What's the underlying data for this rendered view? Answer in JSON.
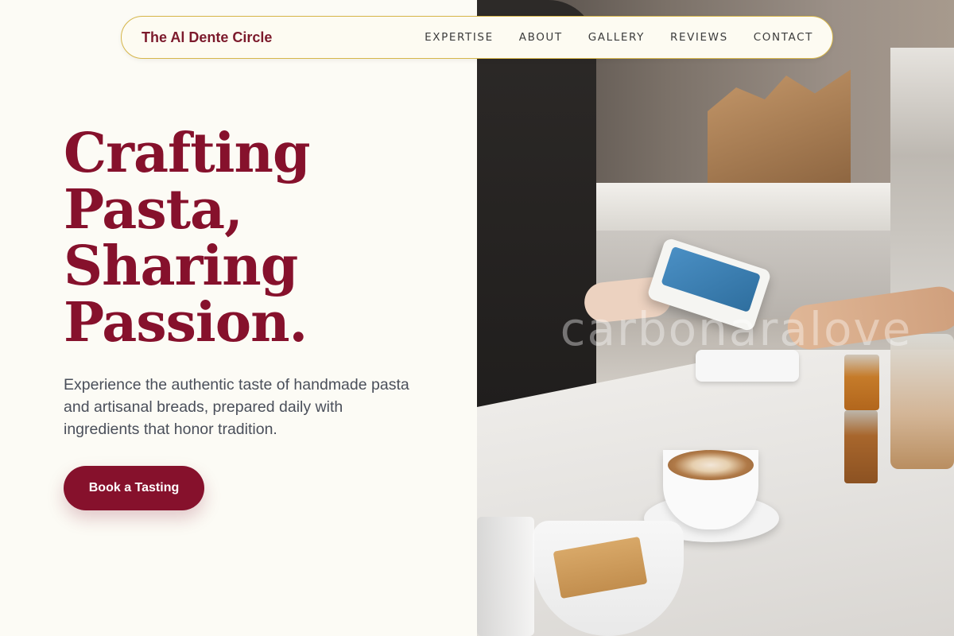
{
  "nav": {
    "brand": "The Al Dente Circle",
    "links": [
      {
        "label": "EXPERTISE"
      },
      {
        "label": "ABOUT"
      },
      {
        "label": "GALLERY"
      },
      {
        "label": "REVIEWS"
      },
      {
        "label": "CONTACT"
      }
    ]
  },
  "hero": {
    "title_lines": [
      "Crafting",
      "Pasta,",
      "Sharing",
      "Passion."
    ],
    "subtitle": "Experience the authentic taste of handmade pasta and artisanal breads, prepared daily with ingredients that honor tradition.",
    "cta_label": "Book a Tasting",
    "image_watermark": "carbonaralove"
  },
  "colors": {
    "brand_primary": "#86112c",
    "nav_border": "#d6b64a",
    "page_background": "#fcfbf5",
    "body_text": "#4a4f5a"
  }
}
